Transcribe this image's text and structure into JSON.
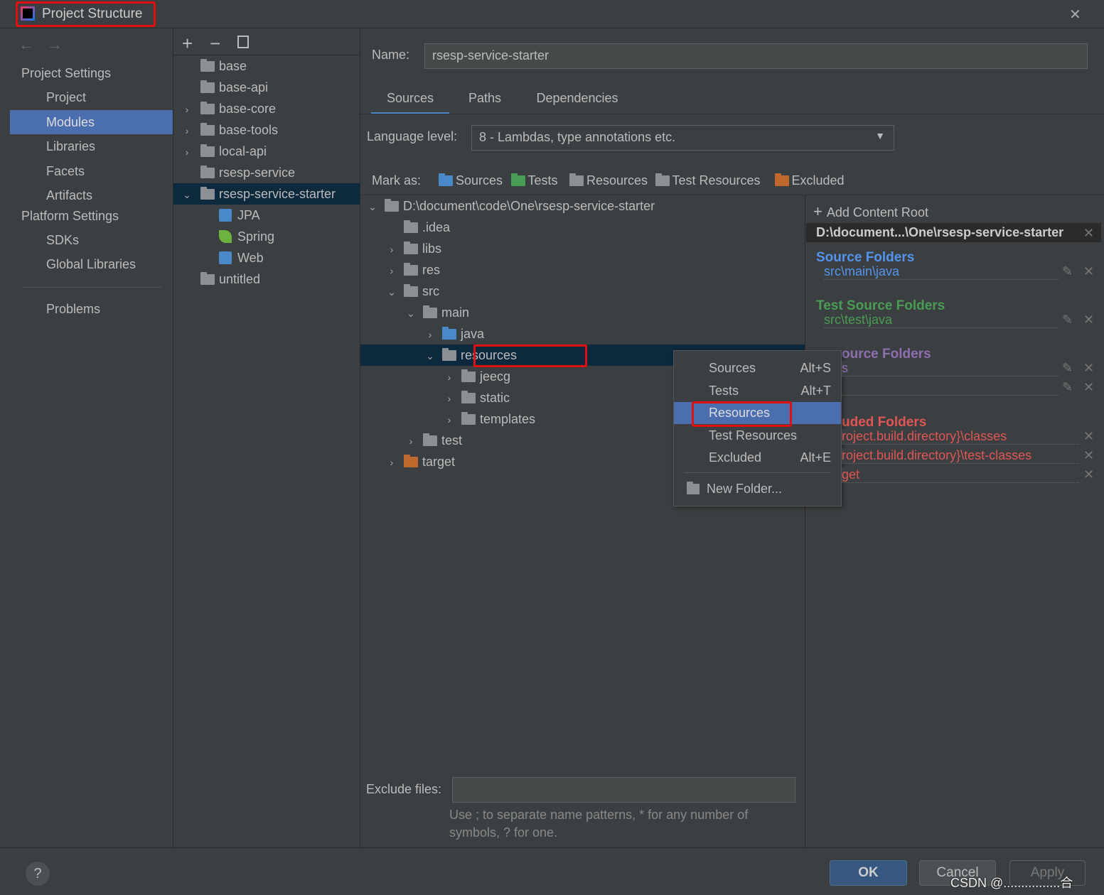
{
  "window": {
    "title": "Project Structure",
    "close": "✕"
  },
  "nav": {
    "section1": "Project Settings",
    "items1": [
      "Project",
      "Modules",
      "Libraries",
      "Facets",
      "Artifacts"
    ],
    "section2": "Platform Settings",
    "items2": [
      "SDKs",
      "Global Libraries"
    ],
    "problems": "Problems",
    "selected": "Modules"
  },
  "modules": [
    {
      "label": "base",
      "chev": ""
    },
    {
      "label": "base-api",
      "chev": ""
    },
    {
      "label": "base-core",
      "chev": "›"
    },
    {
      "label": "base-tools",
      "chev": "›"
    },
    {
      "label": "local-api",
      "chev": "›"
    },
    {
      "label": "rsesp-service",
      "chev": ""
    },
    {
      "label": "rsesp-service-starter",
      "chev": "⌄",
      "selected": true
    },
    {
      "label": "JPA",
      "facet": "jpa-icon",
      "indent": 1
    },
    {
      "label": "Spring",
      "facet": "spring-leaf-icon",
      "indent": 1
    },
    {
      "label": "Web",
      "facet": "web-icon",
      "indent": 1
    },
    {
      "label": "untitled",
      "chev": ""
    }
  ],
  "name": {
    "label": "Name:",
    "value": "rsesp-service-starter"
  },
  "tabs": [
    {
      "label": "Sources",
      "active": true
    },
    {
      "label": "Paths"
    },
    {
      "label": "Dependencies"
    }
  ],
  "language": {
    "label": "Language level:",
    "value": "8 - Lambdas, type annotations etc."
  },
  "mark_as": {
    "label": "Mark as:",
    "options": [
      {
        "label": "Sources",
        "color": "#4a89c8"
      },
      {
        "label": "Tests",
        "color": "#499c54"
      },
      {
        "label": "Resources",
        "color": "#8c9094"
      },
      {
        "label": "Test Resources",
        "color": "#8c9094"
      },
      {
        "label": "Excluded",
        "color": "#c0692e"
      }
    ]
  },
  "tree": [
    {
      "label": "D:\\document\\code\\One\\rsesp-service-starter",
      "depth": 0,
      "chev": "⌄"
    },
    {
      "label": ".idea",
      "depth": 1,
      "chev": ""
    },
    {
      "label": "libs",
      "depth": 1,
      "chev": "›"
    },
    {
      "label": "res",
      "depth": 1,
      "chev": "›"
    },
    {
      "label": "src",
      "depth": 1,
      "chev": "⌄"
    },
    {
      "label": "main",
      "depth": 2,
      "chev": "⌄"
    },
    {
      "label": "java",
      "depth": 3,
      "chev": "›",
      "color": "#4a89c8"
    },
    {
      "label": "resources",
      "depth": 3,
      "chev": "⌄",
      "selected": true
    },
    {
      "label": "jeecg",
      "depth": 4,
      "chev": "›"
    },
    {
      "label": "static",
      "depth": 4,
      "chev": "›"
    },
    {
      "label": "templates",
      "depth": 4,
      "chev": "›"
    },
    {
      "label": "test",
      "depth": 2,
      "chev": "›"
    },
    {
      "label": "target",
      "depth": 1,
      "chev": "›",
      "color": "#c0692e"
    }
  ],
  "context_menu": [
    {
      "label": "Sources",
      "shortcut": "Alt+S"
    },
    {
      "label": "Tests",
      "shortcut": "Alt+T"
    },
    {
      "label": "Resources",
      "shortcut": "",
      "selected": true
    },
    {
      "label": "Test Resources",
      "shortcut": ""
    },
    {
      "label": "Excluded",
      "shortcut": "Alt+E"
    }
  ],
  "new_folder": "New Folder...",
  "roots": {
    "add": "Add Content Root",
    "path": "D:\\document...\\One\\rsesp-service-starter",
    "source_title": "Source Folders",
    "source_items": [
      "src\\main\\java"
    ],
    "test_title": "Test Source Folders",
    "test_items": [
      "src\\test\\java"
    ],
    "res_title": "ource Folders",
    "res_items": [
      "s",
      ""
    ],
    "excl_title": "uded Folders",
    "excl_items": [
      "roject.build.directory}\\classes",
      "roject.build.directory}\\test-classes",
      "get"
    ],
    "colors": {
      "source": "#5394ec",
      "test": "#499c54",
      "resource": "#8e6faf",
      "excluded": "#e05555"
    }
  },
  "exclude": {
    "label": "Exclude files:",
    "value": "",
    "hint1": "Use ; to separate name patterns, * for any number of",
    "hint2": "symbols, ? for one."
  },
  "buttons": {
    "ok": "OK",
    "cancel": "Cancel",
    "apply": "Apply",
    "help": "?"
  },
  "watermark": "CSDN @................合"
}
